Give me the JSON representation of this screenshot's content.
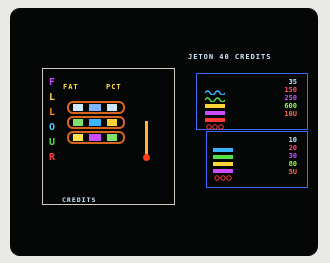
{
  "header": {
    "jeton_label": "JETON  40  CREDITS"
  },
  "footer": {
    "credits_label": "CREDITS"
  },
  "slot_panel": {
    "flipper_letters": [
      {
        "ch": "F",
        "color": "#c94cff"
      },
      {
        "ch": "L",
        "color": "#ffd23a"
      },
      {
        "ch": "L",
        "color": "#ff8a1c"
      },
      {
        "ch": "O",
        "color": "#3ad1ff"
      },
      {
        "ch": "U",
        "color": "#55e24a"
      },
      {
        "ch": "R",
        "color": "#ff3a3a"
      }
    ],
    "fat_label": "FAT",
    "pct_label": "PCT"
  },
  "paytable_1": {
    "icon_names": [
      "wave-icon",
      "wave-icon",
      "bar-icon",
      "bar-icon",
      "bar-icon",
      "ring-icon"
    ],
    "values": [
      {
        "text": "35",
        "color": "#bfe6ff"
      },
      {
        "text": "150",
        "color": "#ff4d6d"
      },
      {
        "text": "250",
        "color": "#c94cff"
      },
      {
        "text": "600",
        "color": "#8cff4a"
      },
      {
        "text": "10U",
        "color": "#ff6b3a"
      }
    ]
  },
  "paytable_2": {
    "icon_names": [
      "bar-icon",
      "bar-icon",
      "bar-icon",
      "bar-icon",
      "ring-icon"
    ],
    "values": [
      {
        "text": "10",
        "color": "#bfe6ff"
      },
      {
        "text": "20",
        "color": "#ff4d6d"
      },
      {
        "text": "30",
        "color": "#c94cff"
      },
      {
        "text": "80",
        "color": "#8cff4a"
      },
      {
        "text": "5U",
        "color": "#ff6b3a"
      }
    ]
  }
}
